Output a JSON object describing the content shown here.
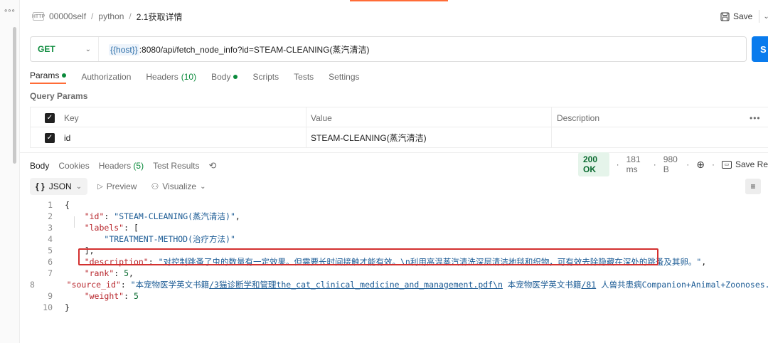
{
  "breadcrumb": {
    "method_badge": "HTTP",
    "items": [
      "00000self",
      "python",
      "2.1获取详情"
    ]
  },
  "toolbar": {
    "save_label": "Save"
  },
  "request": {
    "method": "GET",
    "url_variable": "{{host}}",
    "url_rest": ":8080/api/fetch_node_info?id=STEAM-CLEANING(蒸汽清洁)",
    "send_label": "S"
  },
  "request_tabs": [
    {
      "label": "Params",
      "dot": true
    },
    {
      "label": "Authorization"
    },
    {
      "label": "Headers",
      "count": "(10)"
    },
    {
      "label": "Body",
      "dot": true
    },
    {
      "label": "Scripts"
    },
    {
      "label": "Tests"
    },
    {
      "label": "Settings"
    }
  ],
  "query_params": {
    "title": "Query Params",
    "columns": [
      "Key",
      "Value",
      "Description"
    ],
    "more": "•••",
    "rows": [
      {
        "key": "id",
        "value": "STEAM-CLEANING(蒸汽清洁)",
        "description": ""
      }
    ]
  },
  "response_tabs": [
    {
      "label": "Body"
    },
    {
      "label": "Cookies"
    },
    {
      "label": "Headers",
      "count": "(5)"
    },
    {
      "label": "Test Results"
    }
  ],
  "response_status": {
    "status": "200 OK",
    "time": "181 ms",
    "size": "980 B",
    "save_label": "Save Re"
  },
  "view": {
    "format": "JSON",
    "preview": "Preview",
    "visualize": "Visualize"
  },
  "code_lines": [
    {
      "n": "1",
      "t": "{"
    },
    {
      "n": "2",
      "t": "\"id\": \"STEAM-CLEANING(蒸汽清洁)\","
    },
    {
      "n": "3",
      "t": "\"labels\": ["
    },
    {
      "n": "4",
      "t": "\"TREATMENT-METHOD(治疗方法)\""
    },
    {
      "n": "5",
      "t": "],"
    },
    {
      "n": "6",
      "t": "\"description\": \"对控制跳蚤了虫的数量有一定效果。但需要长时间接触才能有效。\\n利用高温蒸汽清洗深层清洁地毯和织物，可有效去除隐藏在深处的跳蚤及其卵。\","
    },
    {
      "n": "7",
      "t": "\"rank\": 5,"
    },
    {
      "n": "8",
      "t": "\"source_id\": \"本宠物医学英文书籍/3猫诊断学和管理the_cat_clinical_medicine_and_management.pdf\\n 本宠物医学英文书籍/81 人兽共患病Companion+Animal+Zoonoses.pdf\","
    },
    {
      "n": "9",
      "t": "\"weight\": 5"
    },
    {
      "n": "10",
      "t": "}"
    }
  ],
  "code_parts": {
    "l2_key": "\"id\"",
    "l2_val": "\"STEAM-CLEANING(蒸汽清洁)\"",
    "l3_key": "\"labels\"",
    "l4_val": "\"TREATMENT-METHOD(治疗方法)\"",
    "l6_key": "\"description\"",
    "l6_val": "\"对控制跳蚤了虫的数量有一定效果。但需要长时间接触才能有效。\\n利用高温蒸汽清洗深层清洁地毯和织物，可有效去除隐藏在深处的跳蚤及其卵。\"",
    "l7_key": "\"rank\"",
    "l7_val": "5",
    "l8_key": "\"source_id\"",
    "l8_val_a": "\"本宠物医学英文书籍",
    "l8_val_b": "/3猫诊断学和管理the_cat_clinical_medicine_and_management.pdf\\n",
    "l8_val_c": " 本宠物医学英文书籍",
    "l8_val_d": "/81",
    "l8_val_e": " 人兽共患病Companion+Animal+Zoonoses.pdf\"",
    "l9_key": "\"weight\"",
    "l9_val": "5"
  },
  "colors": {
    "accent": "#ff6c37",
    "send": "#097bed",
    "highlight": "#d3302f",
    "status_ok": "#0a6b30"
  }
}
